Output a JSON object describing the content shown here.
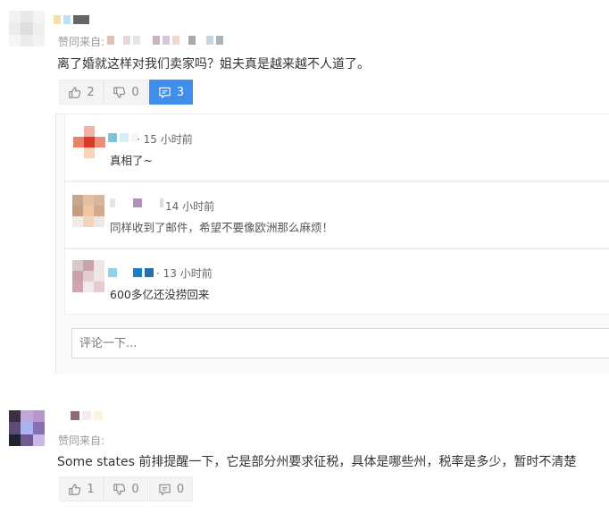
{
  "comments": [
    {
      "via_label": "赞同来自:",
      "text": "离了婚就这样对我们卖家吗？姐夫真是越来越不人道了。",
      "likes": "2",
      "dislikes": "0",
      "reply_count": "3"
    },
    {
      "via_label": "赞同来自:",
      "text": "Some states  前排提醒一下，它是部分州要求征税，具体是哪些州，税率是多少，暂时不清楚",
      "likes": "1",
      "dislikes": "0",
      "reply_count": "0"
    }
  ],
  "replies": [
    {
      "time": "· 15 小时前",
      "text": "真相了~"
    },
    {
      "time": "14 小时前",
      "text": "同样收到了邮件，希望不要像欧洲那么麻烦！"
    },
    {
      "time": "· 13 小时前",
      "text": "600多亿还没捞回来"
    }
  ],
  "comment_input": {
    "placeholder": "评论一下..."
  },
  "icons": [
    "thumbs-up-icon",
    "thumbs-down-icon",
    "comment-icon"
  ],
  "colors": {
    "accent": "#3e8eea",
    "text": "#333333",
    "muted": "#999999"
  }
}
